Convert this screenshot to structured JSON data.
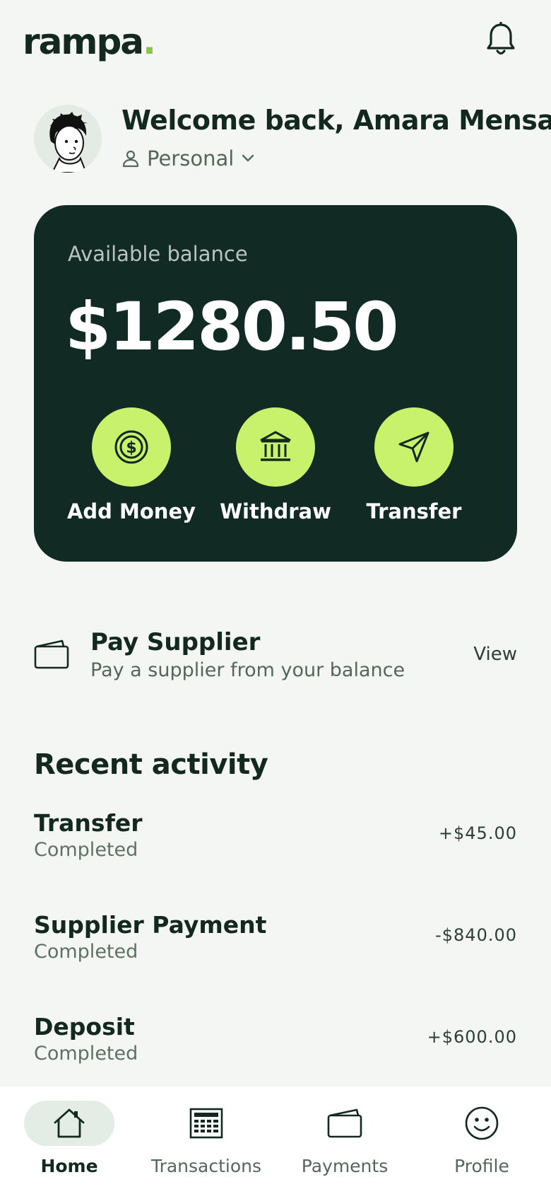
{
  "app": {
    "logo_text": "rampa",
    "logo_dot": ".",
    "accent_color": "#c8f26b",
    "card_color": "#112a24"
  },
  "header": {
    "bell_icon": "bell-icon"
  },
  "user": {
    "welcome_text": "Welcome back, Amara Mensah",
    "account_type": "Personal",
    "account_icon": "person-icon",
    "avatar": "cartoon-avatar"
  },
  "balance": {
    "label": "Available balance",
    "amount": "$1280.50",
    "actions": [
      {
        "label": "Add Money",
        "icon": "dollar-coin-icon"
      },
      {
        "label": "Withdraw",
        "icon": "bank-icon"
      },
      {
        "label": "Transfer",
        "icon": "send-icon"
      }
    ]
  },
  "supplier": {
    "icon": "wallet-icon",
    "title": "Pay Supplier",
    "subtitle": "Pay a supplier from your balance",
    "action": "View"
  },
  "activity": {
    "title": "Recent activity",
    "items": [
      {
        "name": "Transfer",
        "status": "Completed",
        "amount": "+$45.00"
      },
      {
        "name": "Supplier Payment",
        "status": "Completed",
        "amount": "-$840.00"
      },
      {
        "name": "Deposit",
        "status": "Completed",
        "amount": "+$600.00"
      }
    ]
  },
  "tabs": [
    {
      "label": "Home",
      "icon": "home-icon",
      "active": true
    },
    {
      "label": "Transactions",
      "icon": "calculator-icon",
      "active": false
    },
    {
      "label": "Payments",
      "icon": "wallet-icon",
      "active": false
    },
    {
      "label": "Profile",
      "icon": "smiley-icon",
      "active": false
    }
  ]
}
